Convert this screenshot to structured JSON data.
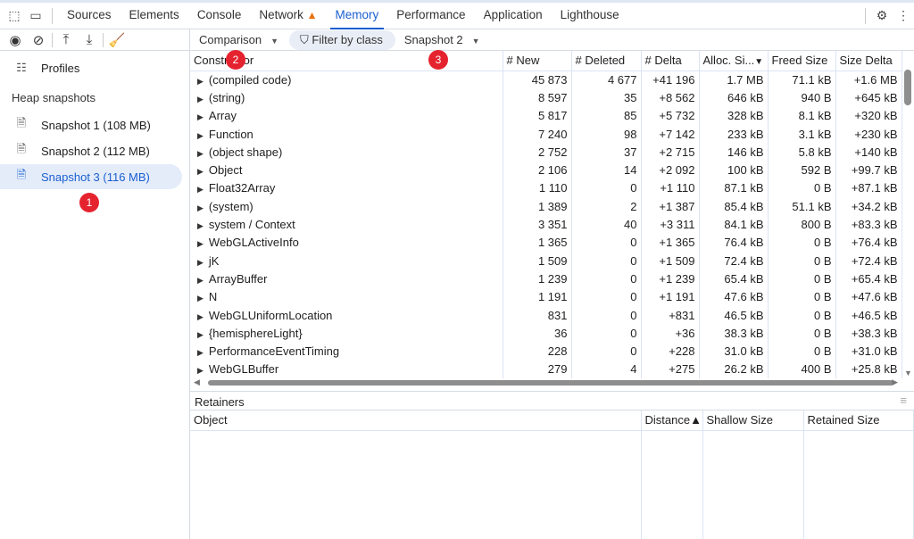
{
  "tabs": {
    "items": [
      {
        "label": "Sources"
      },
      {
        "label": "Elements"
      },
      {
        "label": "Console"
      },
      {
        "label": "Network"
      },
      {
        "label": "Memory",
        "active": true
      },
      {
        "label": "Performance"
      },
      {
        "label": "Application"
      },
      {
        "label": "Lighthouse"
      }
    ]
  },
  "toolbar": {
    "view": "Comparison",
    "filter_placeholder": "Filter by class",
    "base_snapshot": "Snapshot 2"
  },
  "sidebar": {
    "profiles": "Profiles",
    "heading": "Heap snapshots",
    "snapshots": [
      {
        "label": "Snapshot 1 (108 MB)"
      },
      {
        "label": "Snapshot 2 (112 MB)"
      },
      {
        "label": "Snapshot 3 (116 MB)",
        "selected": true
      }
    ]
  },
  "table": {
    "columns": [
      "Constructor",
      "# New",
      "# Deleted",
      "# Delta",
      "Alloc. Si...",
      "Freed Size",
      "Size Delta"
    ],
    "sort_indicator": "▼",
    "rows": [
      [
        "(compiled code)",
        "45 873",
        "4 677",
        "+41 196",
        "1.7 MB",
        "71.1 kB",
        "+1.6 MB"
      ],
      [
        "(string)",
        "8 597",
        "35",
        "+8 562",
        "646 kB",
        "940 B",
        "+645 kB"
      ],
      [
        "Array",
        "5 817",
        "85",
        "+5 732",
        "328 kB",
        "8.1 kB",
        "+320 kB"
      ],
      [
        "Function",
        "7 240",
        "98",
        "+7 142",
        "233 kB",
        "3.1 kB",
        "+230 kB"
      ],
      [
        "(object shape)",
        "2 752",
        "37",
        "+2 715",
        "146 kB",
        "5.8 kB",
        "+140 kB"
      ],
      [
        "Object",
        "2 106",
        "14",
        "+2 092",
        "100 kB",
        "592 B",
        "+99.7 kB"
      ],
      [
        "Float32Array",
        "1 110",
        "0",
        "+1 110",
        "87.1 kB",
        "0 B",
        "+87.1 kB"
      ],
      [
        "(system)",
        "1 389",
        "2",
        "+1 387",
        "85.4 kB",
        "51.1 kB",
        "+34.2 kB"
      ],
      [
        "system / Context",
        "3 351",
        "40",
        "+3 311",
        "84.1 kB",
        "800 B",
        "+83.3 kB"
      ],
      [
        "WebGLActiveInfo",
        "1 365",
        "0",
        "+1 365",
        "76.4 kB",
        "0 B",
        "+76.4 kB"
      ],
      [
        "jK",
        "1 509",
        "0",
        "+1 509",
        "72.4 kB",
        "0 B",
        "+72.4 kB"
      ],
      [
        "ArrayBuffer",
        "1 239",
        "0",
        "+1 239",
        "65.4 kB",
        "0 B",
        "+65.4 kB"
      ],
      [
        "N",
        "1 191",
        "0",
        "+1 191",
        "47.6 kB",
        "0 B",
        "+47.6 kB"
      ],
      [
        "WebGLUniformLocation",
        "831",
        "0",
        "+831",
        "46.5 kB",
        "0 B",
        "+46.5 kB"
      ],
      [
        "{hemisphereLight}",
        "36",
        "0",
        "+36",
        "38.3 kB",
        "0 B",
        "+38.3 kB"
      ],
      [
        "PerformanceEventTiming",
        "228",
        "0",
        "+228",
        "31.0 kB",
        "0 B",
        "+31.0 kB"
      ],
      [
        "WebGLBuffer",
        "279",
        "4",
        "+275",
        "26.2 kB",
        "400 B",
        "+25.8 kB"
      ]
    ]
  },
  "retainers": {
    "title": "Retainers",
    "columns": [
      "Object",
      "Distance▲",
      "Shallow Size",
      "Retained Size"
    ]
  },
  "annotations": [
    "1",
    "2",
    "3"
  ]
}
